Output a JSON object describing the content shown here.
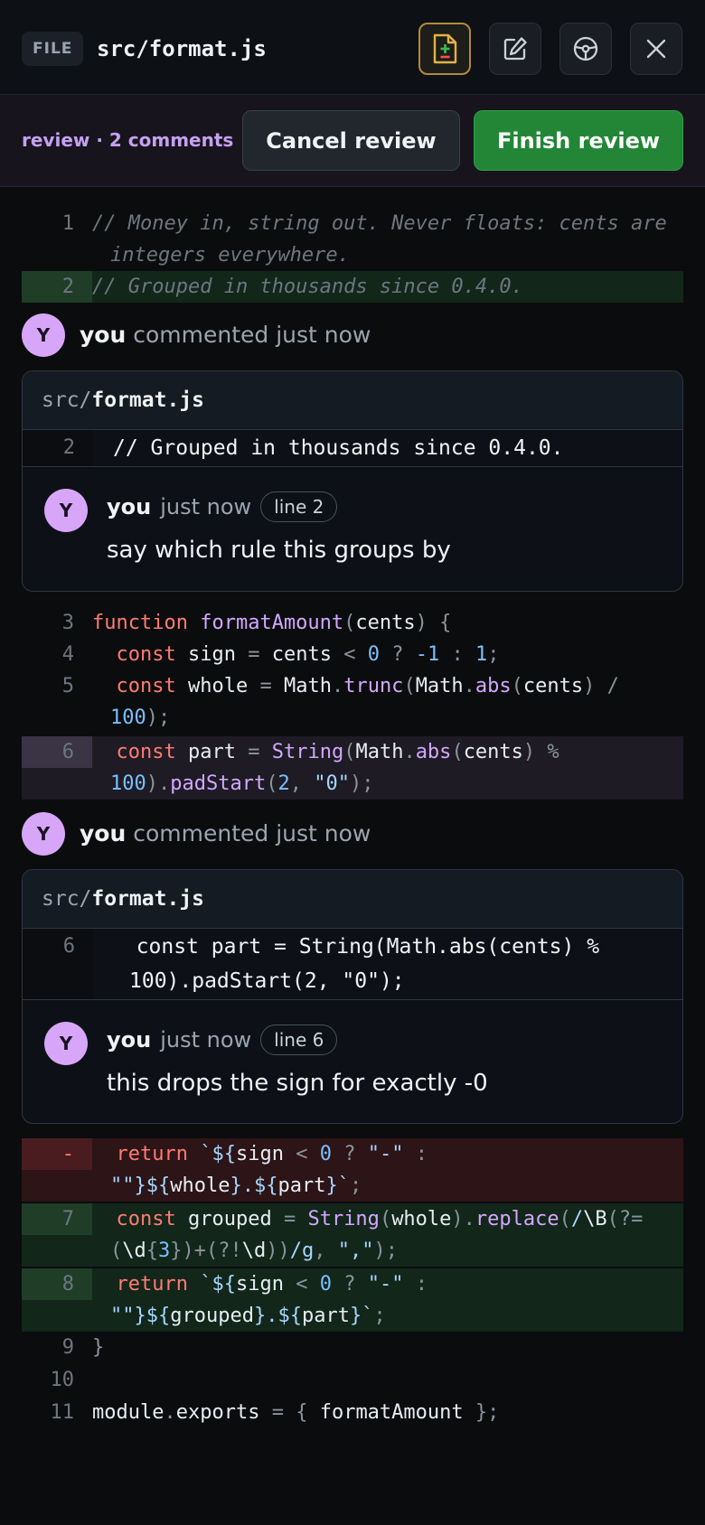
{
  "header": {
    "file_badge": "FILE",
    "file_path": "src/format.js",
    "icons": [
      "file-diff-icon",
      "edit-icon",
      "steering-wheel-icon",
      "close-icon"
    ]
  },
  "review": {
    "status": "review · 2 comments",
    "cancel_label": "Cancel review",
    "finish_label": "Finish review"
  },
  "lines": {
    "l1": {
      "num": "1",
      "text": "// Money in, string out. Never floats: cents are integers everywhere."
    },
    "l2": {
      "num": "2",
      "text": "// Grouped in thousands since 0.4.0."
    },
    "l3": {
      "num": "3"
    },
    "l4": {
      "num": "4"
    },
    "l5": {
      "num": "5"
    },
    "l6": {
      "num": "6"
    },
    "ldel": {
      "num": "-"
    },
    "l7": {
      "num": "7"
    },
    "l8": {
      "num": "8"
    },
    "l9": {
      "num": "9",
      "text": "}"
    },
    "l10": {
      "num": "10",
      "text": ""
    },
    "l11": {
      "num": "11"
    }
  },
  "tokens": {
    "function": "function",
    "formatAmount": "formatAmount",
    "cents": "cents",
    "const": "const",
    "sign": "sign",
    "whole": "whole",
    "part": "part",
    "grouped": "grouped",
    "Math": "Math",
    "trunc": "trunc",
    "abs": "abs",
    "String": "String",
    "padStart": "padStart",
    "replace": "replace",
    "return": "return",
    "module": "module",
    "exports": "exports"
  },
  "comments": [
    {
      "author": "you",
      "header_action": "commented just now",
      "avatar_letter": "Y",
      "file_dir": "src/",
      "file_name": "format.js",
      "snippet_line": "2",
      "snippet_text": "// Grouped in thousands since 0.4.0.",
      "time": "just now",
      "line_label": "line 2",
      "body": "say which rule this groups by"
    },
    {
      "author": "you",
      "header_action": "commented just now",
      "avatar_letter": "Y",
      "file_dir": "src/",
      "file_name": "format.js",
      "snippet_line": "6",
      "snippet_text": "  const part = String(Math.abs(cents) % 100).padStart(2, \"0\");",
      "time": "just now",
      "line_label": "line 6",
      "body": "this drops the sign for exactly -0"
    }
  ],
  "colors": {
    "accent_purple": "#c6a0f2",
    "finish_green": "#238636",
    "added_line": "#12261a",
    "removed_line": "#2d1416"
  }
}
